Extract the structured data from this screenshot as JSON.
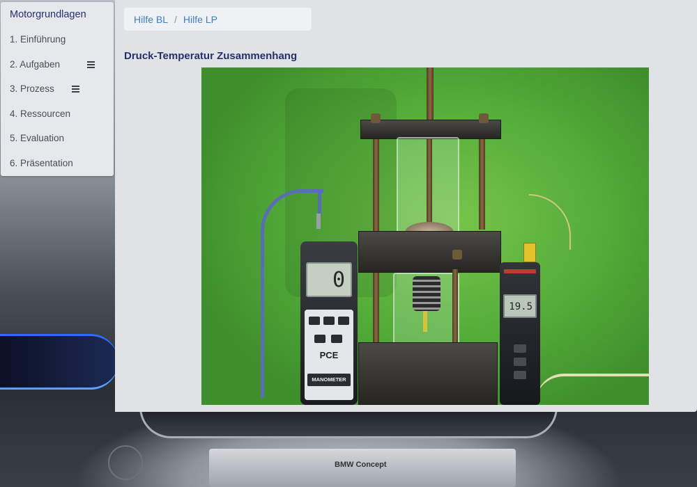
{
  "sidebar": {
    "title": "Motorgrundlagen",
    "items": [
      {
        "label": "1. Einführung",
        "has_menu": false
      },
      {
        "label": "2. Aufgaben",
        "has_menu": true
      },
      {
        "label": "3. Prozess",
        "has_menu": true
      },
      {
        "label": "4. Ressourcen",
        "has_menu": false
      },
      {
        "label": "5. Evaluation",
        "has_menu": false
      },
      {
        "label": "6. Präsentation",
        "has_menu": false
      }
    ]
  },
  "breadcrumb": {
    "items": [
      "Hilfe BL",
      "Hilfe LP"
    ],
    "separator": "/"
  },
  "main": {
    "title": "Druck-Temperatur Zusammenhang"
  },
  "video": {
    "manometer_reading": "0",
    "manometer_brand": "PCE",
    "manometer_label": "MANOMETER",
    "thermometer_reading": "19.5"
  },
  "background": {
    "plate_text": "BMW Concept"
  },
  "colors": {
    "accent": "#24306e",
    "link": "#3f7dc2",
    "panel": "#e1e2e6",
    "video_green": "#54ad39"
  }
}
